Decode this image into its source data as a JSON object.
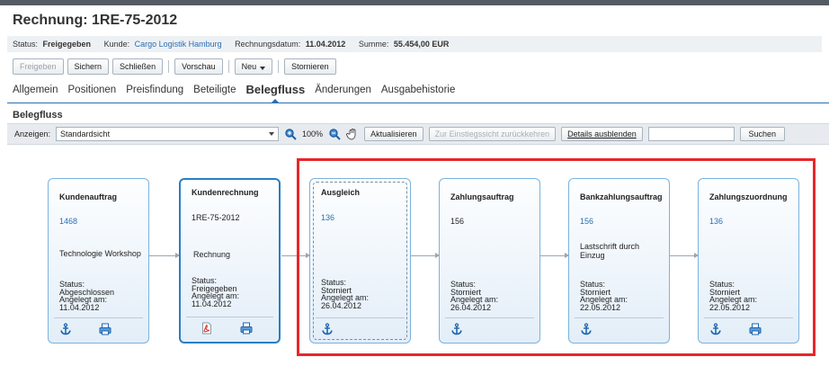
{
  "page": {
    "title": "Rechnung: 1RE-75-2012",
    "status_bar": {
      "status_label": "Status:",
      "status_value": "Freigegeben",
      "customer_label": "Kunde:",
      "customer_value": "Cargo Logistik Hamburg",
      "date_label": "Rechnungsdatum:",
      "date_value": "11.04.2012",
      "sum_label": "Summe:",
      "sum_value": "55.454,00 EUR"
    }
  },
  "toolbar": {
    "release": "Freigeben",
    "save": "Sichern",
    "close": "Schließen",
    "preview": "Vorschau",
    "new": "Neu",
    "cancel": "Stornieren"
  },
  "tabs": [
    {
      "label": "Allgemein",
      "active": false
    },
    {
      "label": "Positionen",
      "active": false
    },
    {
      "label": "Preisfindung",
      "active": false
    },
    {
      "label": "Beteiligte",
      "active": false
    },
    {
      "label": "Belegfluss",
      "active": true
    },
    {
      "label": "Änderungen",
      "active": false
    },
    {
      "label": "Ausgabehistorie",
      "active": false
    }
  ],
  "section_title": "Belegfluss",
  "flow_toolbar": {
    "show_label": "Anzeigen:",
    "view_value": "Standardsicht",
    "zoom": "100%",
    "refresh": "Aktualisieren",
    "back_to_initial": "Zur Einstiegssicht zurückkehren",
    "hide_details": "Details ausblenden",
    "search_value": "",
    "search": "Suchen"
  },
  "nodes": [
    {
      "title": "Kundenauftrag",
      "id": "1468",
      "id_link": true,
      "desc": "Technologie Workshop",
      "status_label": "Status:",
      "status": "Abgeschlossen",
      "created_label": "Angelegt am:",
      "created": "11.04.2012",
      "icons": [
        "anchor-icon",
        "print-icon"
      ]
    },
    {
      "title": "Kundenrechnung",
      "id": "1RE-75-2012",
      "id_link": false,
      "desc": "Rechnung",
      "status_label": "Status:",
      "status": "Freigegeben",
      "created_label": "Angelegt am:",
      "created": "11.04.2012",
      "icons": [
        "pdf-icon",
        "print-icon"
      ]
    },
    {
      "title": "Ausgleich",
      "id": "136",
      "id_link": true,
      "desc": "",
      "status_label": "Status:",
      "status": "Storniert",
      "created_label": "Angelegt am:",
      "created": "26.04.2012",
      "icons": [
        "anchor-icon"
      ]
    },
    {
      "title": "Zahlungsauftrag",
      "id": "156",
      "id_link": false,
      "desc": "",
      "status_label": "Status:",
      "status": "Storniert",
      "created_label": "Angelegt am:",
      "created": "26.04.2012",
      "icons": [
        "anchor-icon"
      ]
    },
    {
      "title": "Bankzahlungsauftrag",
      "id": "156",
      "id_link": true,
      "desc": "Lastschrift durch Einzug",
      "status_label": "Status:",
      "status": "Storniert",
      "created_label": "Angelegt am:",
      "created": "22.05.2012",
      "icons": [
        "anchor-icon"
      ]
    },
    {
      "title": "Zahlungszuordnung",
      "id": "136",
      "id_link": true,
      "desc": "",
      "status_label": "Status:",
      "status": "Storniert",
      "created_label": "Angelegt am:",
      "created": "22.05.2012",
      "icons": [
        "anchor-icon",
        "print-icon"
      ]
    }
  ],
  "colors": {
    "accent": "#2a6fb3",
    "highlight": "#e8262b",
    "node_border": "#79b3de"
  }
}
